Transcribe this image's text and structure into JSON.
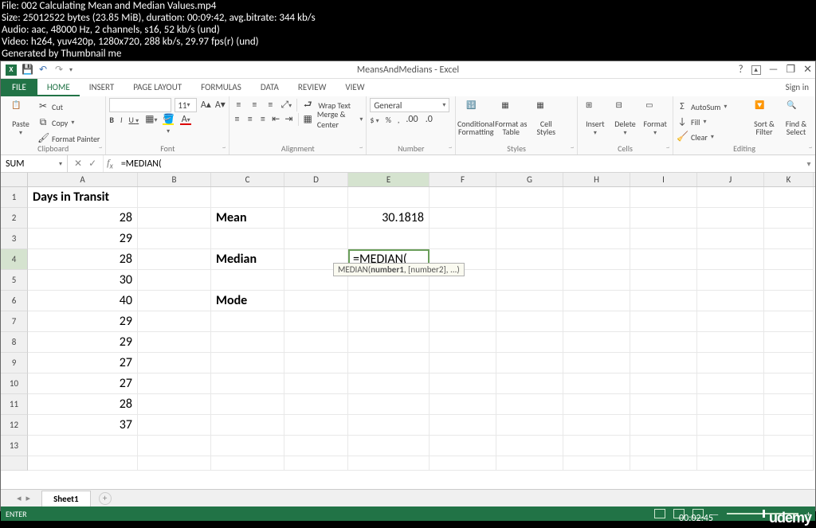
{
  "overlay": {
    "line1": "File: 002 Calculating Mean and Median Values.mp4",
    "line2": "Size: 25012522 bytes (23.85 MiB), duration: 00:09:42, avg.bitrate: 344 kb/s",
    "line3": "Audio: aac, 48000 Hz, 2 channels, s16, 52 kb/s (und)",
    "line4": "Video: h264, yuv420p, 1280x720, 288 kb/s, 29.97 fps(r) (und)",
    "line5": "Generated by Thumbnail me"
  },
  "window_title": "MeansAndMedians - Excel",
  "tabs": {
    "file": "FILE",
    "home": "HOME",
    "insert": "INSERT",
    "page_layout": "PAGE LAYOUT",
    "formulas": "FORMULAS",
    "data": "DATA",
    "review": "REVIEW",
    "view": "VIEW"
  },
  "signin": "Sign in",
  "ribbon": {
    "clipboard": {
      "label": "Clipboard",
      "paste": "Paste",
      "cut": "Cut",
      "copy": "Copy",
      "painter": "Format Painter"
    },
    "font": {
      "label": "Font",
      "font_name": "",
      "font_size": "11",
      "b": "B",
      "i": "I",
      "u": "U"
    },
    "alignment": {
      "label": "Alignment",
      "wrap": "Wrap Text",
      "merge": "Merge & Center"
    },
    "number": {
      "label": "Number",
      "format": "General"
    },
    "styles": {
      "label": "Styles",
      "cond": "Conditional\nFormatting",
      "table": "Format as\nTable",
      "cell": "Cell\nStyles"
    },
    "cells": {
      "label": "Cells",
      "insert": "Insert",
      "delete": "Delete",
      "format": "Format"
    },
    "editing": {
      "label": "Editing",
      "autosum": "AutoSum",
      "fill": "Fill",
      "clear": "Clear",
      "sort": "Sort &\nFilter",
      "find": "Find &\nSelect"
    }
  },
  "name_box": "SUM",
  "formula_text": "=MEDIAN(",
  "tooltip_text": "MEDIAN(number1, [number2], ...)",
  "columns": [
    "A",
    "B",
    "C",
    "D",
    "E",
    "F",
    "G",
    "H",
    "I",
    "J",
    "K"
  ],
  "grid": [
    {
      "r": 1,
      "A": "Days in Transit"
    },
    {
      "r": 2,
      "A": "28",
      "C": "Mean",
      "E": "30.1818"
    },
    {
      "r": 3,
      "A": "29"
    },
    {
      "r": 4,
      "A": "28",
      "C": "Median",
      "E_edit": "=MEDIAN("
    },
    {
      "r": 5,
      "A": "30"
    },
    {
      "r": 6,
      "A": "40",
      "C": "Mode"
    },
    {
      "r": 7,
      "A": "29"
    },
    {
      "r": 8,
      "A": "29"
    },
    {
      "r": 9,
      "A": "27"
    },
    {
      "r": 10,
      "A": "27"
    },
    {
      "r": 11,
      "A": "28"
    },
    {
      "r": 12,
      "A": "37"
    },
    {
      "r": 13
    }
  ],
  "sheet_name": "Sheet1",
  "status": "ENTER",
  "timestamp": "00:02:45",
  "logo": "udemy"
}
